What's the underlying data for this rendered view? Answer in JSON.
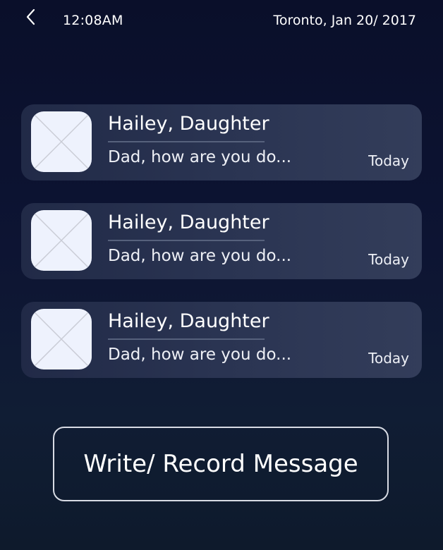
{
  "status_bar": {
    "back_icon": "chevron-left-icon",
    "time": "12:08AM",
    "location_date": "Toronto, Jan 20/ 2017"
  },
  "messages": [
    {
      "avatar_icon": "image-placeholder-icon",
      "sender": "Hailey, Daughter",
      "preview": "Dad, how are you do...",
      "date": "Today"
    },
    {
      "avatar_icon": "image-placeholder-icon",
      "sender": "Hailey, Daughter",
      "preview": "Dad, how are you do...",
      "date": "Today"
    },
    {
      "avatar_icon": "image-placeholder-icon",
      "sender": "Hailey, Daughter",
      "preview": "Dad, how are you do...",
      "date": "Today"
    }
  ],
  "compose": {
    "label": "Write/ Record Message"
  },
  "colors": {
    "background": "#0d1433",
    "card": "#2a3452",
    "avatar": "#eef2fd",
    "text": "#ffffff"
  }
}
